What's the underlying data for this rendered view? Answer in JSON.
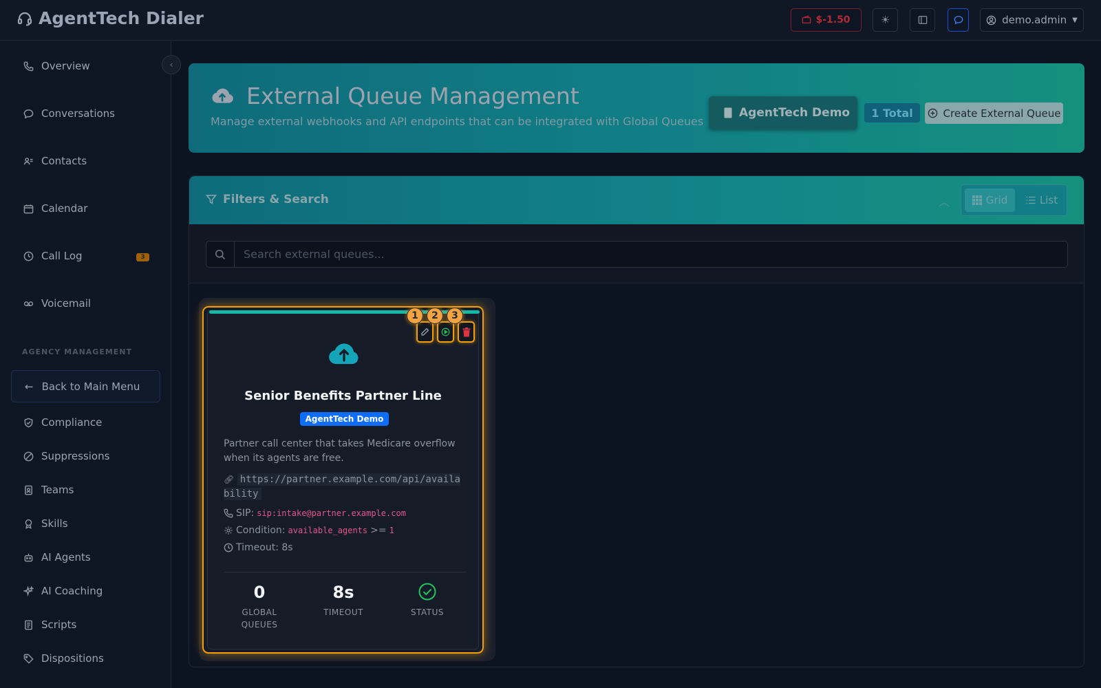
{
  "app": {
    "title": "AgentTech Dialer"
  },
  "topbar": {
    "balance": "$-1.50",
    "user": "demo.admin"
  },
  "sidebar": {
    "items": [
      {
        "label": "Overview",
        "icon": "phone-icon"
      },
      {
        "label": "Conversations",
        "icon": "chat-icon"
      },
      {
        "label": "Contacts",
        "icon": "contacts-icon"
      },
      {
        "label": "Calendar",
        "icon": "calendar-icon"
      },
      {
        "label": "Call Log",
        "icon": "clock-icon",
        "badge": "3"
      },
      {
        "label": "Voicemail",
        "icon": "voicemail-icon"
      }
    ],
    "section_title": "AGENCY MANAGEMENT",
    "back_label": "Back to Main Menu",
    "agency_items": [
      {
        "label": "Compliance",
        "icon": "shield-icon"
      },
      {
        "label": "Suppressions",
        "icon": "ban-icon"
      },
      {
        "label": "Teams",
        "icon": "badge-icon"
      },
      {
        "label": "Skills",
        "icon": "award-icon"
      },
      {
        "label": "AI Agents",
        "icon": "robot-icon"
      },
      {
        "label": "AI Coaching",
        "icon": "sparkle-icon"
      },
      {
        "label": "Scripts",
        "icon": "document-icon"
      },
      {
        "label": "Dispositions",
        "icon": "tag-icon"
      }
    ]
  },
  "header": {
    "title": "External Queue Management",
    "subtitle": "Manage external webhooks and API endpoints that can be integrated with Global Queues",
    "agency": "AgentTech Demo",
    "total": "1 Total",
    "create_label": "Create External Queue"
  },
  "filters": {
    "title": "Filters & Search",
    "grid_label": "Grid",
    "list_label": "List",
    "search_placeholder": "Search external queues..."
  },
  "queue": {
    "name": "Senior Benefits Partner Line",
    "agency": "AgentTech Demo",
    "description": "Partner call center that takes Medicare overflow when its agents are free.",
    "url": "https://partner.example.com/api/availability",
    "sip_label": "SIP:",
    "sip": "sip:intake@partner.example.com",
    "condition_label": "Condition:",
    "condition_field": "available_agents",
    "condition_op": ">=",
    "condition_value": "1",
    "timeout_text": "Timeout: 8s",
    "action_badges": [
      "1",
      "2",
      "3"
    ],
    "stats": [
      {
        "value": "0",
        "label": "GLOBAL QUEUES"
      },
      {
        "value": "8s",
        "label": "TIMEOUT"
      },
      {
        "value": "",
        "label": "STATUS",
        "icon": "check-circle-icon"
      }
    ]
  },
  "colors": {
    "accent_teal": "#14b8a6",
    "highlight_orange": "#f59e0b",
    "agency_blue": "#0d6efd",
    "balance_red": "#b02a37",
    "status_green": "#22c55e"
  }
}
